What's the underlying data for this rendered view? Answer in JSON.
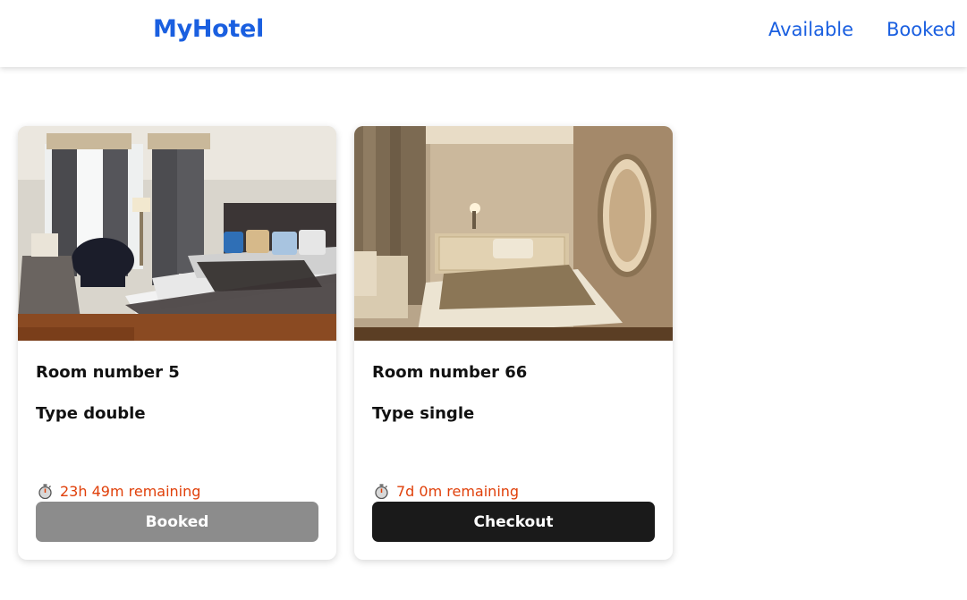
{
  "nav": {
    "brand": "MyHotel",
    "links": [
      "Available",
      "Booked"
    ]
  },
  "rooms": [
    {
      "number_label": "Room number 5",
      "type_label": "Type double",
      "timer_icon": "stopwatch-icon",
      "remaining": "23h 49m remaining",
      "button_label": "Booked",
      "button_color": "#8c8c8c"
    },
    {
      "number_label": "Room number 66",
      "type_label": "Type single",
      "timer_icon": "stopwatch-icon",
      "remaining": "7d 0m remaining",
      "button_label": "Checkout",
      "button_color": "#1a1a1a"
    }
  ],
  "colors": {
    "brand": "#1a5fe0",
    "timer_text": "#e0400a"
  }
}
